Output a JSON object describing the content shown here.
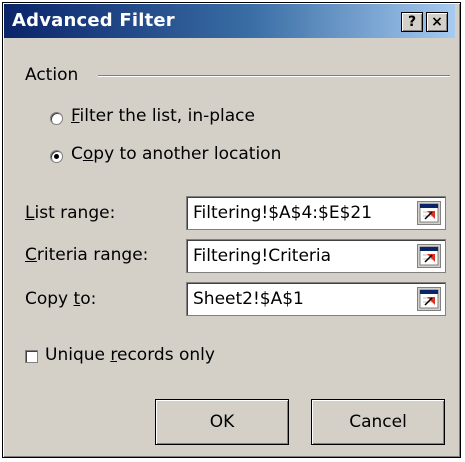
{
  "window": {
    "title": "Advanced Filter",
    "help_button": "?",
    "close_button": "×"
  },
  "action": {
    "group_label": "Action",
    "options": [
      {
        "prefix": "",
        "accel": "F",
        "suffix": "ilter the list, in-place",
        "selected": false
      },
      {
        "prefix": "C",
        "accel": "o",
        "suffix": "py to another location",
        "selected": true
      }
    ]
  },
  "fields": {
    "list_range": {
      "label_accel": "L",
      "label_rest": "ist range:",
      "value": "Filtering!$A$4:$E$21"
    },
    "criteria_range": {
      "label_accel": "C",
      "label_rest": "riteria range:",
      "value": "Filtering!Criteria"
    },
    "copy_to": {
      "label_prefix": "Copy ",
      "label_accel": "t",
      "label_rest": "o:",
      "value": "Sheet2!$A$1"
    }
  },
  "unique": {
    "prefix": "Unique ",
    "accel": "r",
    "suffix": "ecords only",
    "checked": false
  },
  "buttons": {
    "ok": "OK",
    "cancel": "Cancel"
  }
}
